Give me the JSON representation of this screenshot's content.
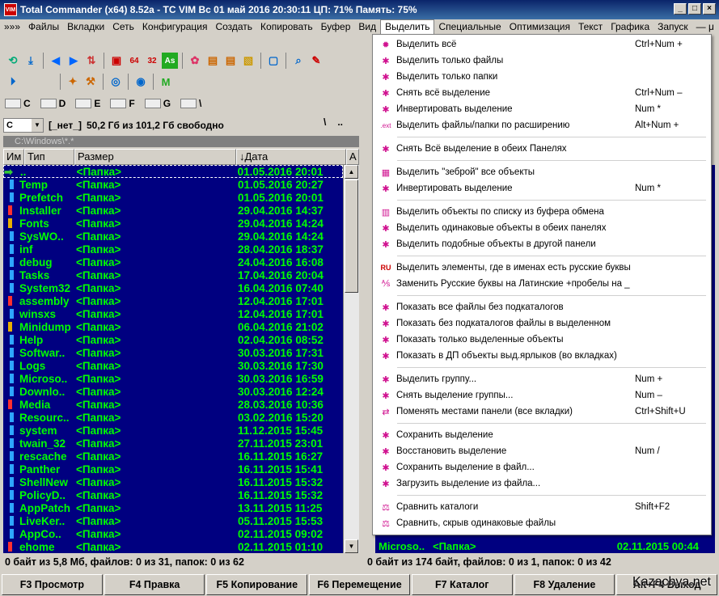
{
  "window": {
    "title": "Total Commander (x64) 8.52a - TC VIM    Вс 01 май 2016    20:30:11    ЦП: 71%    Память: 75%",
    "app_icon": "VIM"
  },
  "menubar": [
    "»»»",
    "Файлы",
    "Вкладки",
    "Сеть",
    "Конфигурация",
    "Создать",
    "Копировать",
    "Буфер",
    "Вид",
    "Выделить",
    "Специальные",
    "Оптимизация",
    "Текст",
    "Графика",
    "Запуск",
    "— μ"
  ],
  "drives": [
    {
      "letter": "C"
    },
    {
      "letter": "D"
    },
    {
      "letter": "E"
    },
    {
      "letter": "F"
    },
    {
      "letter": "G"
    },
    {
      "letter": "\\"
    }
  ],
  "left_panel": {
    "drive": "C",
    "label": "[_нет_]",
    "free_space": "50,2 Гб из 101,2 Гб свободно",
    "path": "C:\\Windows\\*.*",
    "path_buttons": [
      "\\",
      ".."
    ],
    "columns": [
      "Им",
      "Тип",
      "Размер",
      "↓Дата",
      "А"
    ],
    "rows": [
      {
        "name": "..",
        "type": "<Папка>",
        "date": "01.05.2016 20:01",
        "icon": "arrow"
      },
      {
        "name": "Temp",
        "type": "<Папка>",
        "date": "01.05.2016 20:27",
        "icon": "folder"
      },
      {
        "name": "Prefetch",
        "type": "<Папка>",
        "date": "01.05.2016 20:01",
        "icon": "folder"
      },
      {
        "name": "Installer",
        "type": "<Папка>",
        "date": "29.04.2016 14:37",
        "icon": "warn"
      },
      {
        "name": "Fonts",
        "type": "<Папка>",
        "date": "29.04.2016 14:24",
        "icon": "lock"
      },
      {
        "name": "SysWO..",
        "type": "<Папка>",
        "date": "29.04.2016 14:24",
        "icon": "folder"
      },
      {
        "name": "inf",
        "type": "<Папка>",
        "date": "28.04.2016 18:37",
        "icon": "folder"
      },
      {
        "name": "debug",
        "type": "<Папка>",
        "date": "24.04.2016 16:08",
        "icon": "folder"
      },
      {
        "name": "Tasks",
        "type": "<Папка>",
        "date": "17.04.2016 20:04",
        "icon": "folder"
      },
      {
        "name": "System32",
        "type": "<Папка>",
        "date": "16.04.2016 07:40",
        "icon": "folder"
      },
      {
        "name": "assembly",
        "type": "<Папка>",
        "date": "12.04.2016 17:01",
        "icon": "warn"
      },
      {
        "name": "winsxs",
        "type": "<Папка>",
        "date": "12.04.2016 17:01",
        "icon": "folder"
      },
      {
        "name": "Minidump",
        "type": "<Папка>",
        "date": "06.04.2016 21:02",
        "icon": "lock"
      },
      {
        "name": "Help",
        "type": "<Папка>",
        "date": "02.04.2016 08:52",
        "icon": "folder"
      },
      {
        "name": "Softwar..",
        "type": "<Папка>",
        "date": "30.03.2016 17:31",
        "icon": "folder"
      },
      {
        "name": "Logs",
        "type": "<Папка>",
        "date": "30.03.2016 17:30",
        "icon": "folder"
      },
      {
        "name": "Microso..",
        "type": "<Папка>",
        "date": "30.03.2016 16:59",
        "icon": "folder"
      },
      {
        "name": "Downlo..",
        "type": "<Папка>",
        "date": "30.03.2016 12:24",
        "icon": "folder"
      },
      {
        "name": "Media",
        "type": "<Папка>",
        "date": "28.03.2016 10:36",
        "icon": "warn"
      },
      {
        "name": "Resourc..",
        "type": "<Папка>",
        "date": "03.02.2016 15:20",
        "icon": "folder"
      },
      {
        "name": "system",
        "type": "<Папка>",
        "date": "11.12.2015 15:45",
        "icon": "folder"
      },
      {
        "name": "twain_32",
        "type": "<Папка>",
        "date": "27.11.2015 23:01",
        "icon": "folder"
      },
      {
        "name": "rescache",
        "type": "<Папка>",
        "date": "16.11.2015 16:27",
        "icon": "folder"
      },
      {
        "name": "Panther",
        "type": "<Папка>",
        "date": "16.11.2015 15:41",
        "icon": "folder"
      },
      {
        "name": "ShellNew",
        "type": "<Папка>",
        "date": "16.11.2015 15:32",
        "icon": "folder"
      },
      {
        "name": "PolicyD..",
        "type": "<Папка>",
        "date": "16.11.2015 15:32",
        "icon": "folder"
      },
      {
        "name": "AppPatch",
        "type": "<Папка>",
        "date": "13.11.2015 11:25",
        "icon": "folder"
      },
      {
        "name": "LiveKer..",
        "type": "<Папка>",
        "date": "05.11.2015 15:53",
        "icon": "folder"
      },
      {
        "name": "AppCo..",
        "type": "<Папка>",
        "date": "02.11.2015 09:02",
        "icon": "folder"
      },
      {
        "name": "ehome",
        "type": "<Папка>",
        "date": "02.11.2015 01:10",
        "icon": "warn"
      }
    ],
    "status": "0 байт из 5,8 Мб, файлов: 0 из 31, папок: 0 из 62"
  },
  "right_panel": {
    "last_row": {
      "name": "Microso..",
      "type": "<Папка>",
      "date": "02.11.2015 00:44"
    },
    "status": "0 байт из 174 байт, файлов: 0 из 1, папок: 0 из 42"
  },
  "select_menu": {
    "items": [
      {
        "label": "Выделить всё",
        "key": "Ctrl+Num +",
        "icon": "gear-icon"
      },
      {
        "label": "Выделить только файлы",
        "key": "",
        "icon": "select-files-icon"
      },
      {
        "label": "Выделить только папки",
        "key": "",
        "icon": "select-folders-icon"
      },
      {
        "label": "Снять всё выделение",
        "key": "Ctrl+Num –",
        "icon": "unselect-icon"
      },
      {
        "label": "Инвертировать выделение",
        "key": "Num *",
        "icon": "invert-icon"
      },
      {
        "label": "Выделить файлы/папки по расширению",
        "key": "Alt+Num +",
        "icon": "ext-icon"
      },
      {
        "sep": true
      },
      {
        "label": "Снять Всё выделение в обеих Панелях",
        "key": "",
        "icon": "unselect-both-icon"
      },
      {
        "sep": true
      },
      {
        "label": "Выделить \"зеброй\" все объекты",
        "key": "",
        "icon": "zebra-icon"
      },
      {
        "label": "Инвертировать выделение",
        "key": "Num *",
        "icon": "invert-icon"
      },
      {
        "sep": true
      },
      {
        "label": "Выделить объекты по списку из буфера обмена",
        "key": "",
        "icon": "clipboard-icon"
      },
      {
        "label": "Выделить одинаковые объекты в обеих панелях",
        "key": "",
        "icon": "same-objects-icon"
      },
      {
        "label": "Выделить подобные объекты в другой панели",
        "key": "",
        "icon": "similar-icon"
      },
      {
        "sep": true
      },
      {
        "label": "Выделить элементы, где в именах есть русские буквы",
        "key": "",
        "icon": "ru-icon"
      },
      {
        "label": "Заменить Русские буквы на Латинские +пробелы на _",
        "key": "",
        "icon": "translit-icon"
      },
      {
        "sep": true
      },
      {
        "label": "Показать все файлы без подкаталогов",
        "key": "",
        "icon": "flat-view-icon"
      },
      {
        "label": "Показать без подкаталогов  файлы в выделенном",
        "key": "",
        "icon": "flat-selected-icon"
      },
      {
        "label": "Показать только выделенные объекты",
        "key": "",
        "icon": "show-selected-icon"
      },
      {
        "label": "Показать в ДП объекты выд.ярлыков (во вкладках)",
        "key": "",
        "icon": "shortcut-icon"
      },
      {
        "sep": true
      },
      {
        "label": "Выделить группу...",
        "key": "Num +",
        "icon": "select-group-icon"
      },
      {
        "label": "Снять выделение группы...",
        "key": "Num –",
        "icon": "unselect-group-icon"
      },
      {
        "label": "Поменять местами панели (все вкладки)",
        "key": "Ctrl+Shift+U",
        "icon": "swap-panels-icon"
      },
      {
        "sep": true
      },
      {
        "label": "Сохранить выделение",
        "key": "",
        "icon": "save-selection-icon"
      },
      {
        "label": "Восстановить выделение",
        "key": "Num /",
        "icon": "restore-selection-icon"
      },
      {
        "label": "Сохранить выделение в файл...",
        "key": "",
        "icon": "save-to-file-icon"
      },
      {
        "label": "Загрузить выделение из файла...",
        "key": "",
        "icon": "load-from-file-icon"
      },
      {
        "sep": true
      },
      {
        "label": "Сравнить каталоги",
        "key": "Shift+F2",
        "icon": "compare-icon"
      },
      {
        "label": "Сравнить, скрыв одинаковые файлы",
        "key": "",
        "icon": "compare-hide-icon"
      }
    ]
  },
  "fkeys": [
    "F3 Просмотр",
    "F4 Правка",
    "F5 Копирование",
    "F6 Перемещение",
    "F7 Каталог",
    "F8 Удаление",
    "Alt+F4 Выход"
  ],
  "watermark": "Kazachya.net"
}
